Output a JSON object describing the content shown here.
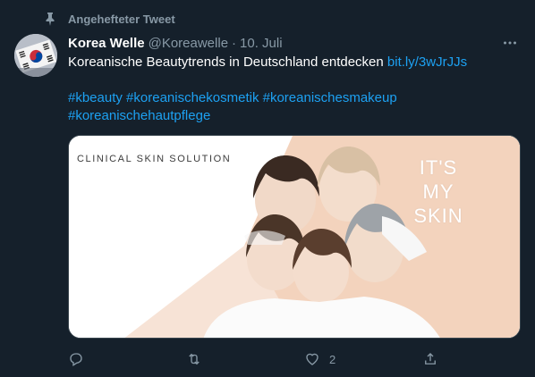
{
  "pinned": {
    "label": "Angehefteter Tweet",
    "icon": "pin-icon"
  },
  "author": {
    "name": "Korea Welle",
    "handle": "@Koreawelle",
    "separator": "·",
    "date": "10. Juli",
    "avatar_icon": "korea-flag-avatar"
  },
  "tweet": {
    "text": "Koreanische Beautytrends in Deutschland entdecken",
    "link": "bit.ly/3wJrJJs",
    "hashtags_line1": "#kbeauty #koreanischekosmetik #koreanischesmakeup",
    "hashtags_line2": "#koreanischehautpflege"
  },
  "media": {
    "brand": "CLINICAL SKIN SOLUTION",
    "slogan_line1": "IT'S",
    "slogan_line2": "MY",
    "slogan_line3": "SKIN"
  },
  "actions": {
    "reply": {
      "icon": "reply-icon",
      "count": ""
    },
    "retweet": {
      "icon": "retweet-icon",
      "count": ""
    },
    "like": {
      "icon": "heart-icon",
      "count": "2"
    },
    "share": {
      "icon": "share-icon",
      "count": ""
    }
  },
  "colors": {
    "background": "#15202b",
    "secondary_text": "#8899a6",
    "link": "#1da1f2",
    "image_peach": "#f3d3bd"
  }
}
